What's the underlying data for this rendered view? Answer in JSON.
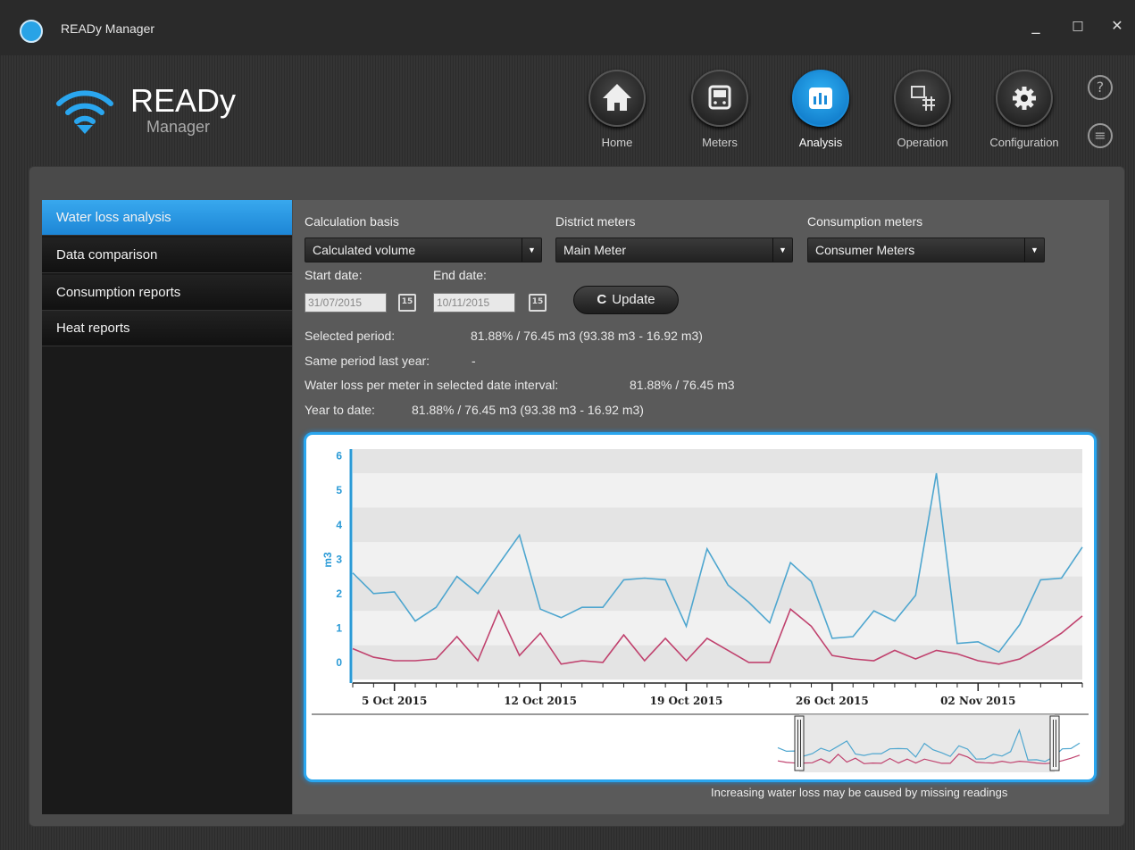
{
  "window": {
    "title": "READy Manager",
    "minimize": "_",
    "maximize": "□",
    "close": "✕"
  },
  "logo": {
    "title": "READy",
    "subtitle": "Manager"
  },
  "nav": [
    {
      "label": "Home",
      "icon": "home-icon",
      "active": false
    },
    {
      "label": "Meters",
      "icon": "meter-icon",
      "active": false
    },
    {
      "label": "Analysis",
      "icon": "chart-icon",
      "active": true
    },
    {
      "label": "Operation",
      "icon": "operation-icon",
      "active": false
    },
    {
      "label": "Configuration",
      "icon": "gear-icon",
      "active": false
    }
  ],
  "help": {
    "help_glyph": "?",
    "menu_glyph": "≡"
  },
  "sidebar": {
    "items": [
      {
        "label": "Water loss analysis",
        "active": true
      },
      {
        "label": "Data comparison",
        "active": false
      },
      {
        "label": "Consumption reports",
        "active": false
      },
      {
        "label": "Heat reports",
        "active": false
      }
    ]
  },
  "filters": {
    "calculation_basis": {
      "label": "Calculation basis",
      "value": "Calculated volume"
    },
    "district_meters": {
      "label": "District meters",
      "value": "Main Meter"
    },
    "consumption_meters": {
      "label": "Consumption meters",
      "value": "Consumer Meters"
    },
    "start_date": {
      "label": "Start date:",
      "value": "31/07/2015"
    },
    "end_date": {
      "label": "End date:",
      "value": "10/11/2015"
    },
    "calendar_glyph": "15",
    "update_label": "Update",
    "update_glyph": "C"
  },
  "stats": {
    "selected_period_label": "Selected period:",
    "selected_period_value": "81.88% / 76.45 m3 (93.38 m3 - 16.92 m3)",
    "same_period_label": "Same period last year:",
    "same_period_value": "-",
    "per_meter_label": "Water loss per meter in selected date interval:",
    "per_meter_value": "81.88% / 76.45 m3",
    "ytd_label": "Year to date:",
    "ytd_value": "81.88% / 76.45 m3 (93.38 m3 - 16.92 m3)"
  },
  "chart_data": {
    "type": "line",
    "ylabel": "m3",
    "ylim": [
      0,
      6
    ],
    "yticks": [
      "0",
      "1",
      "2",
      "3",
      "4",
      "5",
      "6"
    ],
    "xticks": [
      "5 Oct 2015",
      "12 Oct 2015",
      "19 Oct 2015",
      "26 Oct 2015",
      "02 Nov 2015"
    ],
    "grid": true,
    "colors": {
      "blue": "#4ea6cf",
      "red": "#c0426e",
      "axis": "#2a9ad6"
    },
    "series": [
      {
        "color": "#4ea6cf",
        "values": [
          2.6,
          2.0,
          2.05,
          1.2,
          1.6,
          2.5,
          2.0,
          2.85,
          3.7,
          1.55,
          1.3,
          1.6,
          1.6,
          2.4,
          2.45,
          2.4,
          1.05,
          3.3,
          2.25,
          1.75,
          1.15,
          2.9,
          2.35,
          0.7,
          0.75,
          1.5,
          1.2,
          1.95,
          5.5,
          0.55,
          0.6,
          0.3,
          1.1,
          2.4,
          2.45,
          3.35
        ]
      },
      {
        "color": "#c0426e",
        "values": [
          0.4,
          0.15,
          0.05,
          0.05,
          0.1,
          0.75,
          0.05,
          1.5,
          0.2,
          0.85,
          -0.05,
          0.05,
          0.0,
          0.8,
          0.05,
          0.7,
          0.05,
          0.7,
          0.35,
          0.0,
          0.0,
          1.55,
          1.05,
          0.2,
          0.1,
          0.05,
          0.35,
          0.1,
          0.35,
          0.25,
          0.05,
          -0.05,
          0.1,
          0.45,
          0.85,
          1.35
        ]
      }
    ]
  },
  "footnote": "Increasing water loss may be caused by missing readings"
}
